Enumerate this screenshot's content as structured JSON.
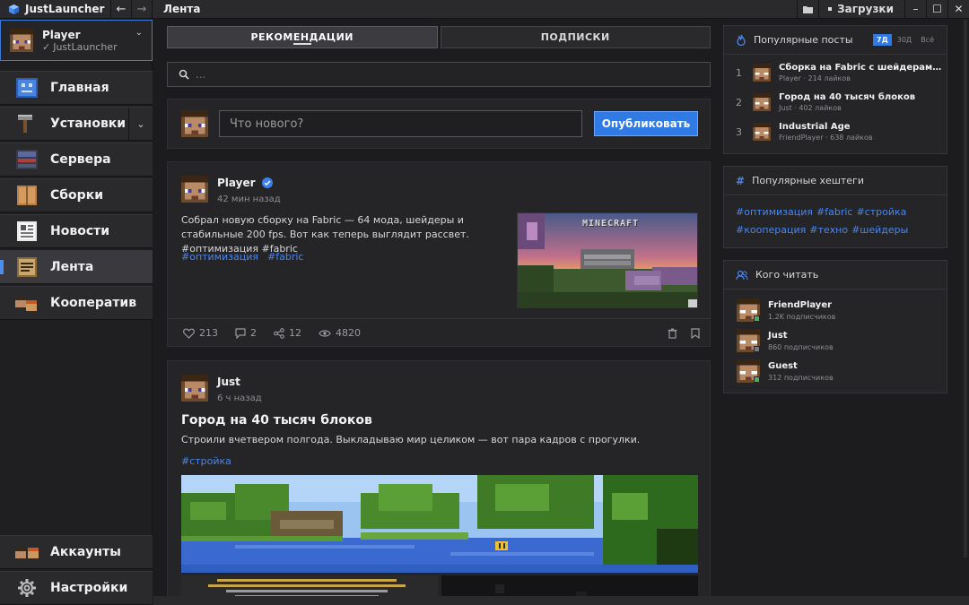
{
  "window": {
    "app_name": "JustLauncher",
    "page_title": "Лента",
    "downloads_label": "Загрузки",
    "back_glyph": "←",
    "forward_glyph": "→",
    "minimize_glyph": "–",
    "maximize_glyph": "☐",
    "close_glyph": "✕"
  },
  "user": {
    "name": "Player",
    "sub": "JustLauncher",
    "check_glyph": "✓",
    "chevron_glyph": "⌄"
  },
  "sidebar": {
    "items": [
      {
        "label": "Главная",
        "icon": "home-icon"
      },
      {
        "label": "Установки",
        "icon": "hammer-icon"
      },
      {
        "label": "Сервера",
        "icon": "server-icon"
      },
      {
        "label": "Сборки",
        "icon": "box-icon"
      },
      {
        "label": "Новости",
        "icon": "news-icon"
      },
      {
        "label": "Лента",
        "icon": "feed-icon",
        "active": true
      },
      {
        "label": "Кооператив",
        "icon": "coop-icon"
      }
    ],
    "bottom": [
      {
        "label": "Аккаунты",
        "icon": "accounts-icon"
      },
      {
        "label": "Настройки",
        "icon": "gear-icon"
      }
    ],
    "expand_glyph": "⌄"
  },
  "feed": {
    "tabs": [
      {
        "label": "РЕКОМЕНДАЦИИ",
        "active": true
      },
      {
        "label": "ПОДПИСКИ",
        "active": false
      }
    ],
    "search_placeholder": "...",
    "composer_placeholder": "Что нового?",
    "publish_label": "Опубликовать",
    "posts": [
      {
        "author": "Player",
        "time": "42 мин назад",
        "text": "Собрал новую сборку на Fabric — 64 мода, шейдеры и стабильные 200 fps. Вот как теперь выглядит рассвет. #оптимизация #fabric",
        "tags": [
          "#оптимизация",
          "#fabric"
        ],
        "likes": "213",
        "comments": "2",
        "shares": "12",
        "views": "4820",
        "image_logo": "MINECRAFT"
      },
      {
        "author": "Just",
        "time": "6 ч назад",
        "title": "Город на 40 тысяч блоков",
        "text": "Строили вчетвером полгода. Выкладываю мир целиком — вот пара кадров с прогулки.",
        "tags": [
          "#стройка"
        ]
      }
    ]
  },
  "popular_posts": {
    "title": "Популярные посты",
    "periods": [
      {
        "label": "7Д",
        "active": true
      },
      {
        "label": "30Д",
        "active": false
      },
      {
        "label": "Всё",
        "active": false
      }
    ],
    "items": [
      {
        "rank": "1",
        "title": "Сборка на Fabric с шейдерами и...",
        "sub": "Player · 214 лайков"
      },
      {
        "rank": "2",
        "title": "Город на 40 тысяч блоков",
        "sub": "Just · 402 лайков"
      },
      {
        "rank": "3",
        "title": "Industrial Age",
        "sub": "FriendPlayer · 638 лайков"
      }
    ]
  },
  "hashtags": {
    "title": "Популярные хештеги",
    "items": [
      "#оптимизация",
      "#fabric",
      "#стройка",
      "#кооперация",
      "#техно",
      "#шейдеры"
    ]
  },
  "who_to_follow": {
    "title": "Кого читать",
    "items": [
      {
        "name": "FriendPlayer",
        "sub": "1.2K подписчиков",
        "online": true
      },
      {
        "name": "Just",
        "sub": "860 подписчиков",
        "online": false
      },
      {
        "name": "Guest",
        "sub": "312 подписчиков",
        "online": true
      }
    ]
  },
  "colors": {
    "accent": "#2f7ae5",
    "hashtag": "#4a86e8",
    "online": "#4caf50"
  }
}
